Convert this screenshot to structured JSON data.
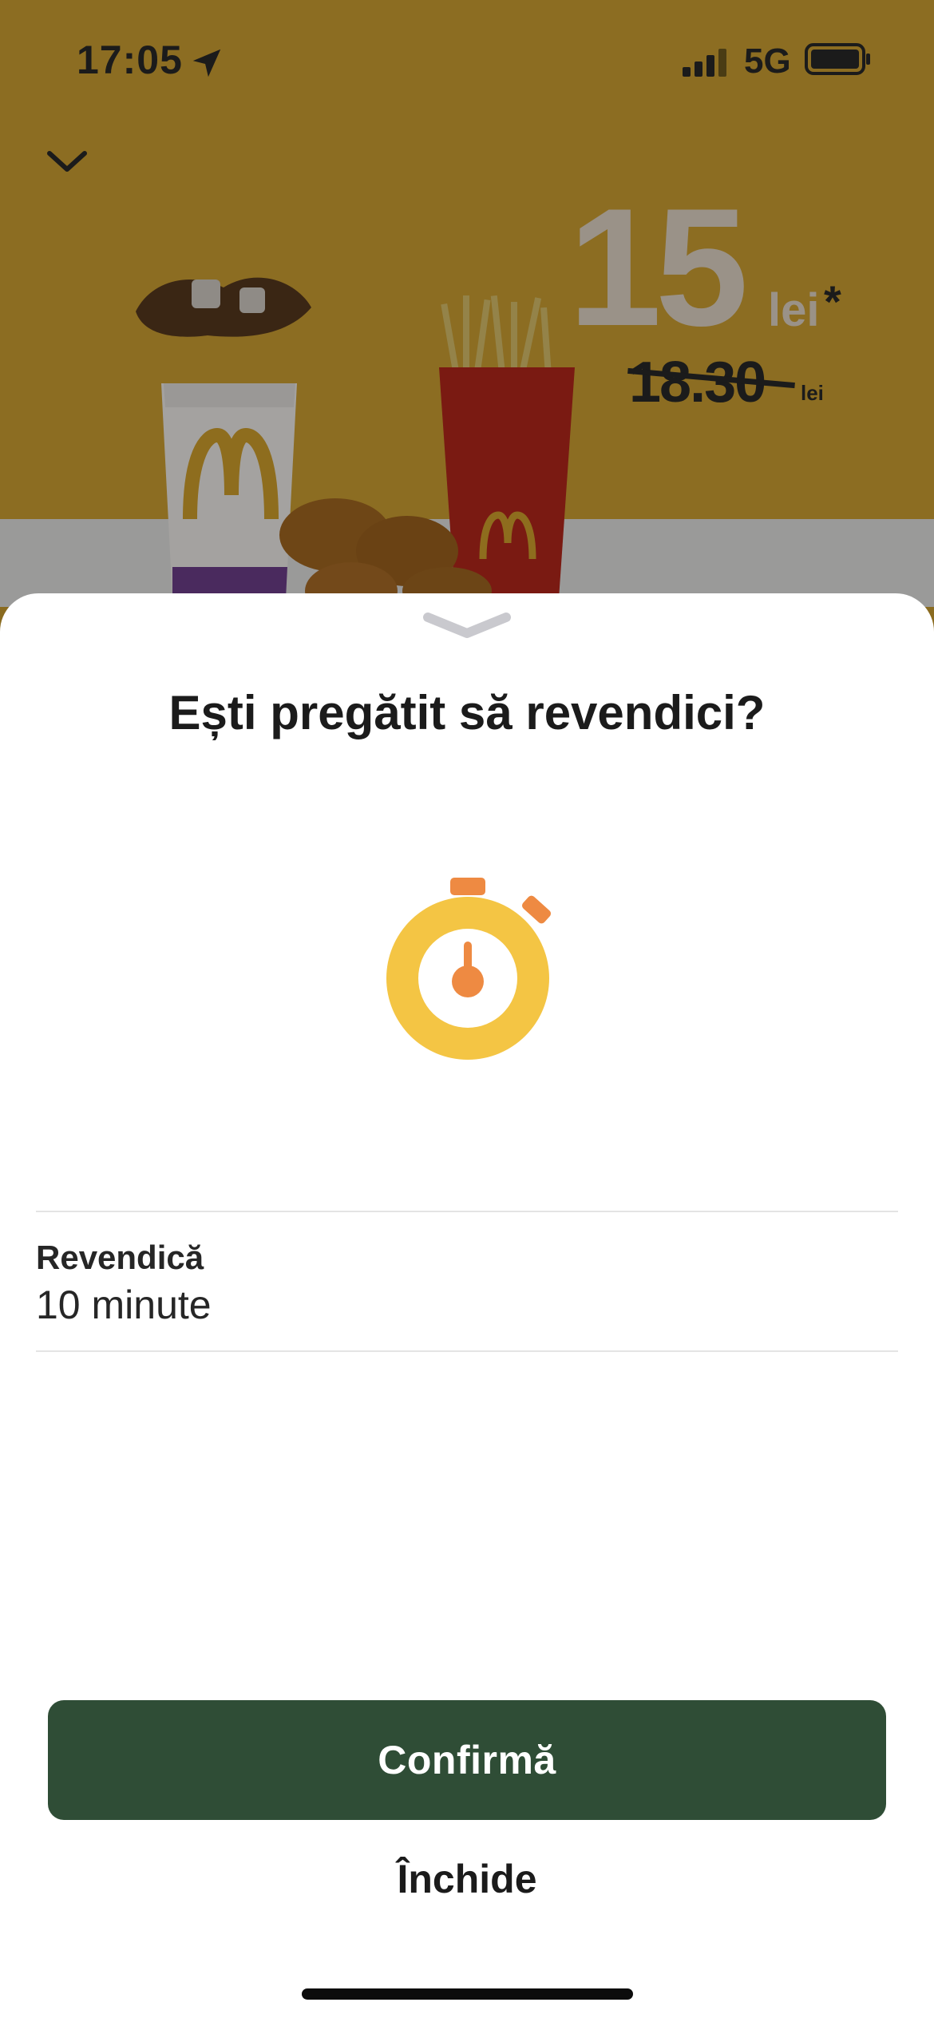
{
  "status_bar": {
    "time": "17:05",
    "network": "5G",
    "icons": [
      "location-arrow-icon",
      "signal-bars-icon",
      "battery-icon"
    ]
  },
  "hero": {
    "collapse_icon": "chevron-down-icon",
    "price": "15",
    "price_unit": "lei",
    "price_asterisk": "*",
    "old_price": "18.30",
    "old_price_unit": "lei"
  },
  "sheet": {
    "grabber_icon": "chevron-down-icon",
    "title": "Ești pregătit să revendici?",
    "timer_icon": "stopwatch-icon",
    "claim_label": "Revendică",
    "claim_value": "10 minute",
    "confirm_label": "Confirmă",
    "close_label": "Închide"
  },
  "colors": {
    "hero_background": "#8c6d22",
    "confirm_button": "#2f4d36",
    "timer_ring": "#f4c544",
    "timer_accent": "#ee8a42",
    "text": "#1b1b1b"
  }
}
